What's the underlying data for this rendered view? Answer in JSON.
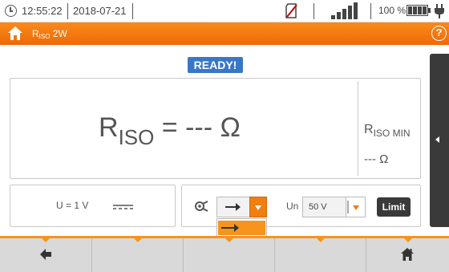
{
  "status": {
    "time": "12:55:22",
    "date": "2018-07-21",
    "battery_percent": "100 %"
  },
  "title": {
    "main": "R",
    "sub": "ISO",
    "suffix": " 2W"
  },
  "badge": "READY!",
  "result": {
    "symbol": "R",
    "symbol_sub": "ISO",
    "value": " = --- Ω",
    "min_symbol": "R",
    "min_sub": "ISO MIN",
    "min_value": "--- Ω"
  },
  "voltage": "U = 1 V",
  "mode_select": {
    "selected": "arrow-right",
    "options": [
      "arrow-right",
      "rotate"
    ]
  },
  "un": {
    "label": "Un",
    "value": "50 V"
  },
  "limit_label": "Limit",
  "colors": {
    "accent": "#f7941d",
    "ready": "#3877c8",
    "dark": "#3a3a3a"
  },
  "icons": {
    "clock": "clock-icon",
    "sd": "sd-card-icon",
    "signal": "signal-icon",
    "battery": "battery-icon",
    "power": "plug-icon",
    "home": "home-icon",
    "help": "help-icon",
    "probe": "probe-icon",
    "back": "back-arrow-icon"
  },
  "help_glyph": "?"
}
